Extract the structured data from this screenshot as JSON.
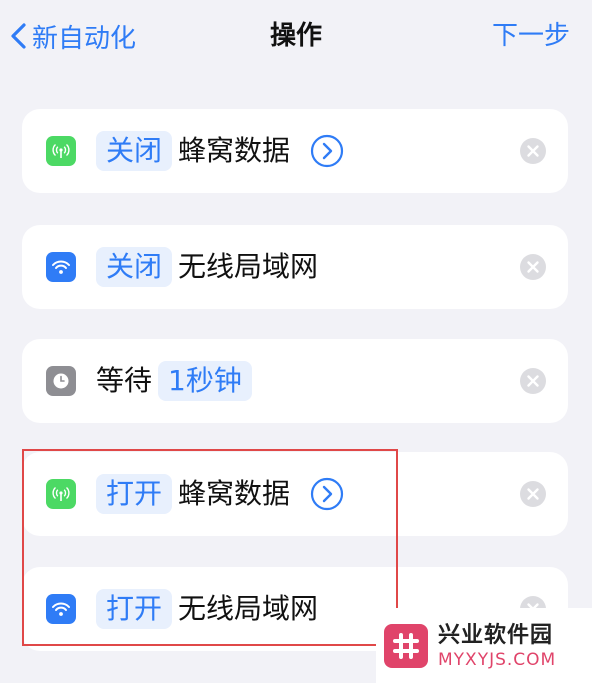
{
  "nav": {
    "back_label": "新自动化",
    "title": "操作",
    "next_label": "下一步"
  },
  "actions": [
    {
      "icon": "cellular-icon",
      "icon_color": "#4cd964",
      "token": "关闭",
      "label": "蜂窝数据",
      "has_arrow": true
    },
    {
      "icon": "wifi-icon",
      "icon_color": "#2f7cf6",
      "token": "关闭",
      "label": "无线局域网",
      "has_arrow": false
    },
    {
      "icon": "clock-icon",
      "icon_color": "#8e8e93",
      "prefix": "等待",
      "token": "1秒钟",
      "has_arrow": false
    },
    {
      "icon": "cellular-icon",
      "icon_color": "#4cd964",
      "token": "打开",
      "label": "蜂窝数据",
      "has_arrow": true
    },
    {
      "icon": "wifi-icon",
      "icon_color": "#2f7cf6",
      "token": "打开",
      "label": "无线局域网",
      "has_arrow": false
    }
  ],
  "watermark": {
    "title": "兴业软件园",
    "url": "MYXYJS.COM"
  },
  "colors": {
    "accent": "#2f7cf6",
    "background": "#f2f2f7",
    "highlight": "#e04848",
    "watermark": "#e0446a"
  }
}
